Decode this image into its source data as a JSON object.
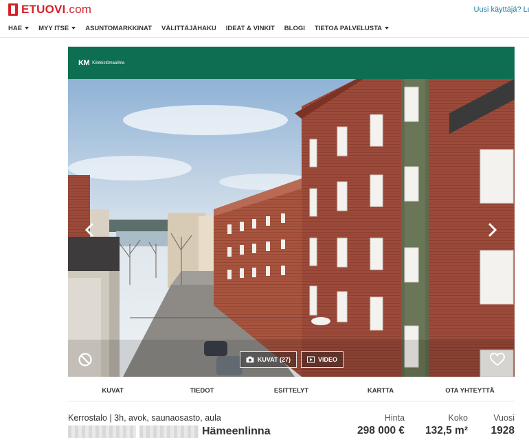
{
  "header": {
    "logo_text": "ETUOVI",
    "logo_domain": ".com",
    "account_link": "Uusi käyttäjä? Luo"
  },
  "nav": [
    {
      "label": "HAE",
      "dropdown": true
    },
    {
      "label": "MYY ITSE",
      "dropdown": true
    },
    {
      "label": "ASUNTOMARKKINAT",
      "dropdown": false
    },
    {
      "label": "VÄLITTÄJÄHAKU",
      "dropdown": false
    },
    {
      "label": "IDEAT & VINKIT",
      "dropdown": false
    },
    {
      "label": "BLOGI",
      "dropdown": false
    },
    {
      "label": "TIETOA PALVELUSTA",
      "dropdown": true
    }
  ],
  "gallery": {
    "brand_abbr": "KM",
    "brand_name": "Kiinteistömaailma",
    "photos_button": "KUVAT (27)",
    "video_button": "VIDEO",
    "icons": {
      "prev": "chevron-left-icon",
      "next": "chevron-right-icon",
      "hide": "ban-icon",
      "favorite": "heart-icon",
      "photos": "camera-icon",
      "video": "play-icon"
    },
    "brand_color": "#0e6e52"
  },
  "tabs": [
    "KUVAT",
    "TIEDOT",
    "ESITTELYT",
    "KARTTA",
    "OTA YHTEYTTÄ"
  ],
  "listing": {
    "property_type": "Kerrostalo | 3h, avok, saunaosasto, aula",
    "city": "Hämeenlinna",
    "price_label": "Hinta",
    "price": "298 000 €",
    "size_label": "Koko",
    "size": "132,5 m²",
    "year_label": "Vuosi",
    "year": "1928"
  },
  "colors": {
    "brand_red": "#d2232a",
    "link_blue": "#1a7aa0"
  }
}
